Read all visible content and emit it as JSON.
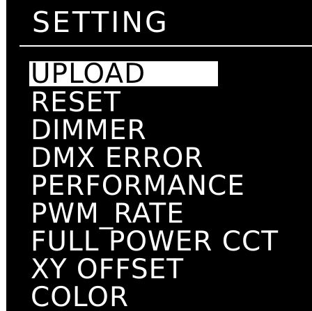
{
  "header": {
    "title": "SETTING"
  },
  "menu": {
    "items": [
      {
        "label": "UPLOAD",
        "selected": true
      },
      {
        "label": "RESET",
        "selected": false
      },
      {
        "label": "DIMMER",
        "selected": false
      },
      {
        "label": "DMX ERROR",
        "selected": false
      },
      {
        "label": "PERFORMANCE",
        "selected": false
      },
      {
        "label": "PWM_RATE",
        "selected": false
      },
      {
        "label": "FULL POWER CCT",
        "selected": false
      },
      {
        "label": "XY OFFSET",
        "selected": false
      },
      {
        "label": "COLOR",
        "selected": false
      }
    ]
  },
  "colors": {
    "background": "#000000",
    "foreground": "#ffffff",
    "selection": "#ffffff"
  }
}
